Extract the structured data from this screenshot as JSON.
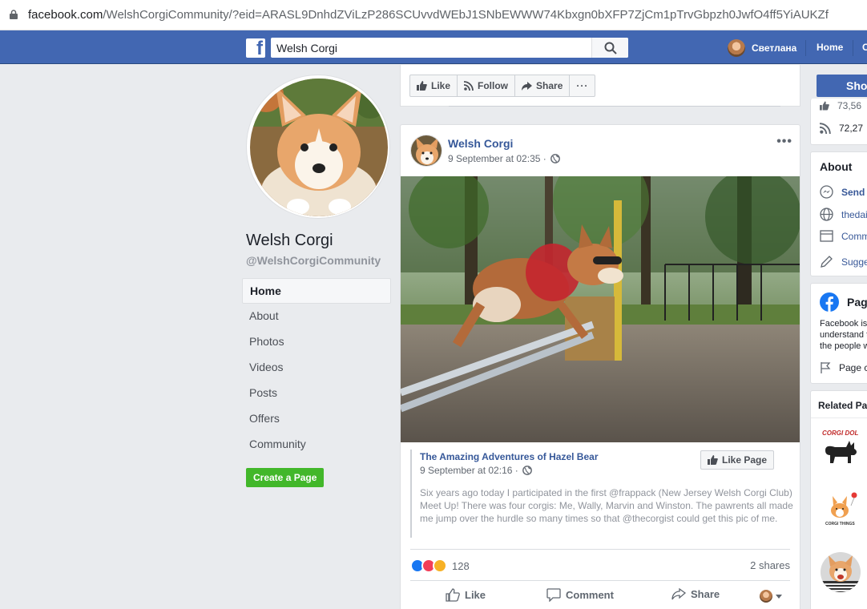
{
  "browser": {
    "url_domain": "facebook.com",
    "url_rest": "/WelshCorgiCommunity/?eid=ARASL9DnhdZViLzP286SCUvvdWEbJ1SNbEWWW74Kbxgn0bXFP7ZjCm1pTrvGbpzh0JwfO4ff5YiAUKZf"
  },
  "topbar": {
    "logo": "f",
    "search_value": "Welsh Corgi",
    "user_name": "Светлана",
    "home_label": "Home",
    "cut_label": "C"
  },
  "page": {
    "name": "Welsh Corgi",
    "handle": "@WelshCorgiCommunity",
    "nav": [
      "Home",
      "About",
      "Photos",
      "Videos",
      "Posts",
      "Offers",
      "Community"
    ],
    "create_page_label": "Create a Page"
  },
  "actions": {
    "like": "Like",
    "follow": "Follow",
    "share": "Share",
    "more": "···"
  },
  "post": {
    "author": "Welsh Corgi",
    "time": "9 September at 02:35",
    "sep": "·",
    "more": "•••",
    "shared": {
      "author": "The Amazing Adventures of Hazel Bear",
      "time": "9 September at 02:16",
      "like_page_label": "Like Page",
      "text": "Six years ago today I participated in the first @frappack (New Jersey Welsh Corgi Club) Meet Up! There was four corgis: Me, Wally, Marvin and Winston. The pawrents all made me jump over the hurdle so many times so that @thecorgist could get this pic of me."
    },
    "reaction_count": "128",
    "shares": "2 shares",
    "buttons": {
      "like": "Like",
      "comment": "Comment",
      "share": "Share"
    }
  },
  "right": {
    "shop_label": "Sho",
    "stat_1": "73,56",
    "stat_2": "72,27",
    "about_title": "About",
    "send_message": "Send",
    "website": "thedai",
    "category": "Comm",
    "suggest": "Sugge",
    "transparency_title": "Page",
    "transparency_text_1": "Facebook is",
    "transparency_text_2": "understand t",
    "transparency_text_3": "the people w",
    "transparency_link": "Page c",
    "related_title": "Related Pa",
    "related_logo_1": "CORGI DOL",
    "related_logo_2": "CORGI THINGS"
  },
  "colors": {
    "fb_blue": "#4267b2",
    "link": "#365899",
    "green": "#42b72a"
  }
}
